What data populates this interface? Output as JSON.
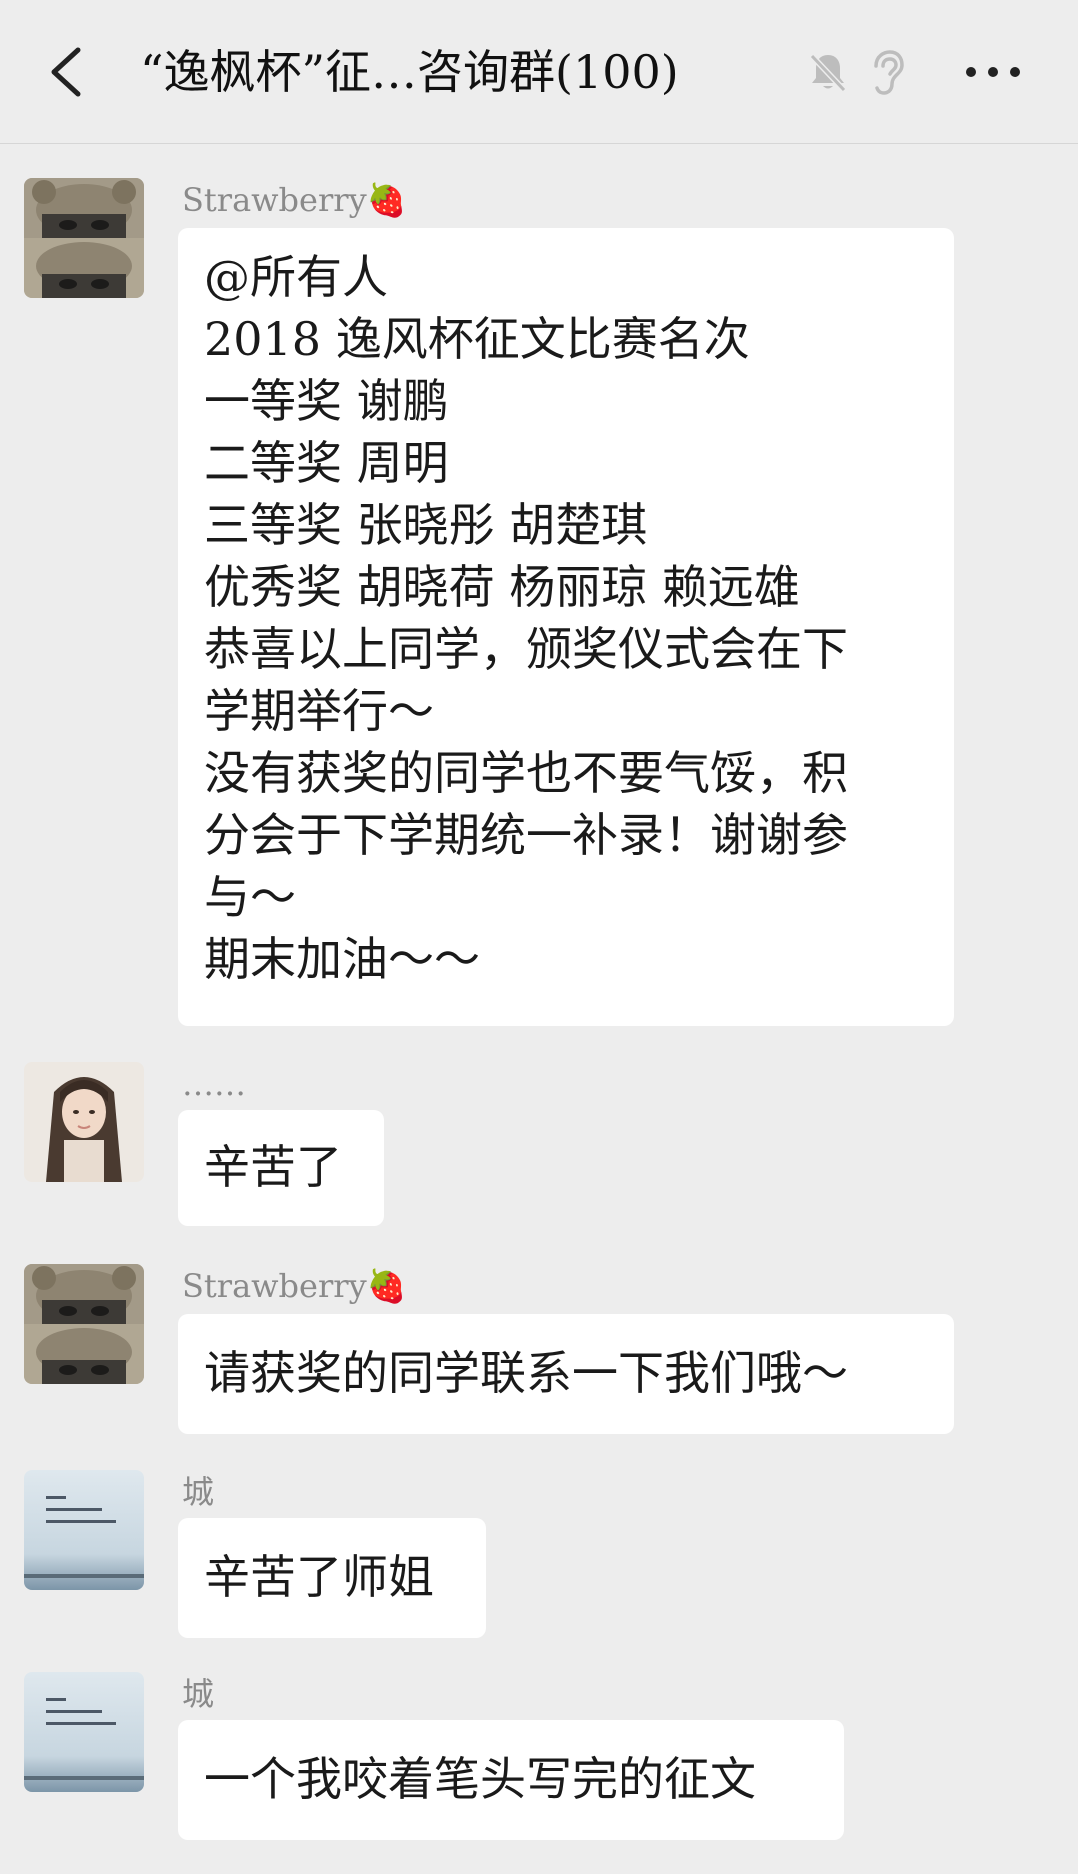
{
  "header": {
    "title": "“逸枫杯”征…咨询群(100)",
    "back_icon": "chevron-left-icon",
    "mute_icon": "bell-muted-icon",
    "ear_icon": "ear-icon",
    "more_icon": "more-dots-icon"
  },
  "messages": [
    {
      "sender": "Strawberry🍓",
      "avatar": "avatar-girl-bear-hat",
      "lines": [
        "@所有人",
        "2018 逸风杯征文比赛名次",
        "一等奖  谢鹏",
        "二等奖  周明",
        "三等奖  张晓彤 胡楚琪",
        "优秀奖  胡晓荷 杨丽琼 赖远雄",
        "恭喜以上同学，颁奖仪式会在下",
        "学期举行～",
        "没有获奖的同学也不要气馁，积",
        "分会于下学期统一补录！谢谢参",
        "与～",
        "期末加油～～"
      ]
    },
    {
      "sender": "……",
      "avatar": "avatar-girl-long-hair",
      "lines": [
        "辛苦了"
      ]
    },
    {
      "sender": "Strawberry🍓",
      "avatar": "avatar-girl-bear-hat",
      "lines": [
        "请获奖的同学联系一下我们哦～"
      ]
    },
    {
      "sender": "城",
      "avatar": "avatar-calligraphy-sky",
      "lines": [
        "辛苦了师姐"
      ]
    },
    {
      "sender": "城",
      "avatar": "avatar-calligraphy-sky",
      "lines": [
        "一个我咬着笔头写完的征文"
      ]
    }
  ],
  "colors": {
    "background": "#ededed",
    "bubble": "#ffffff",
    "sender_text": "#8a8a8a",
    "message_text": "#1a1a1a",
    "strawberry": "#e0303a"
  }
}
